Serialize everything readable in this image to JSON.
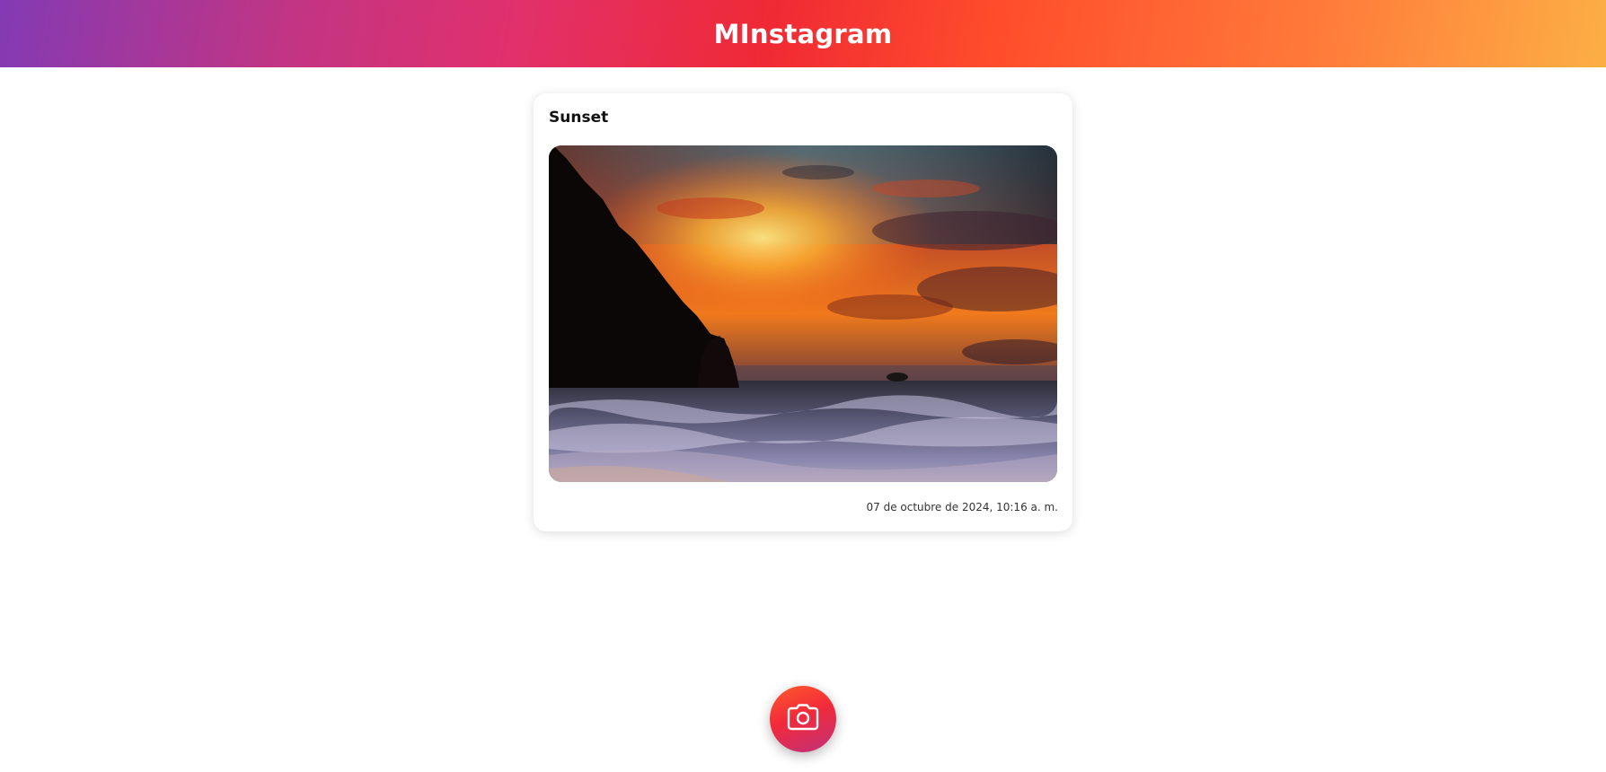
{
  "header": {
    "title": "MInstagram",
    "gradient_colors": [
      "#833ab4",
      "#e1306c",
      "#f02a34",
      "#fcaf45"
    ]
  },
  "feed": {
    "posts": [
      {
        "title": "Sunset",
        "image_description_icon": "sunset-beach-photo",
        "date": "07 de octubre de 2024, 10:16 a. m."
      }
    ]
  },
  "camera_button": {
    "icon": "camera-icon",
    "color": "#f22a3a"
  }
}
